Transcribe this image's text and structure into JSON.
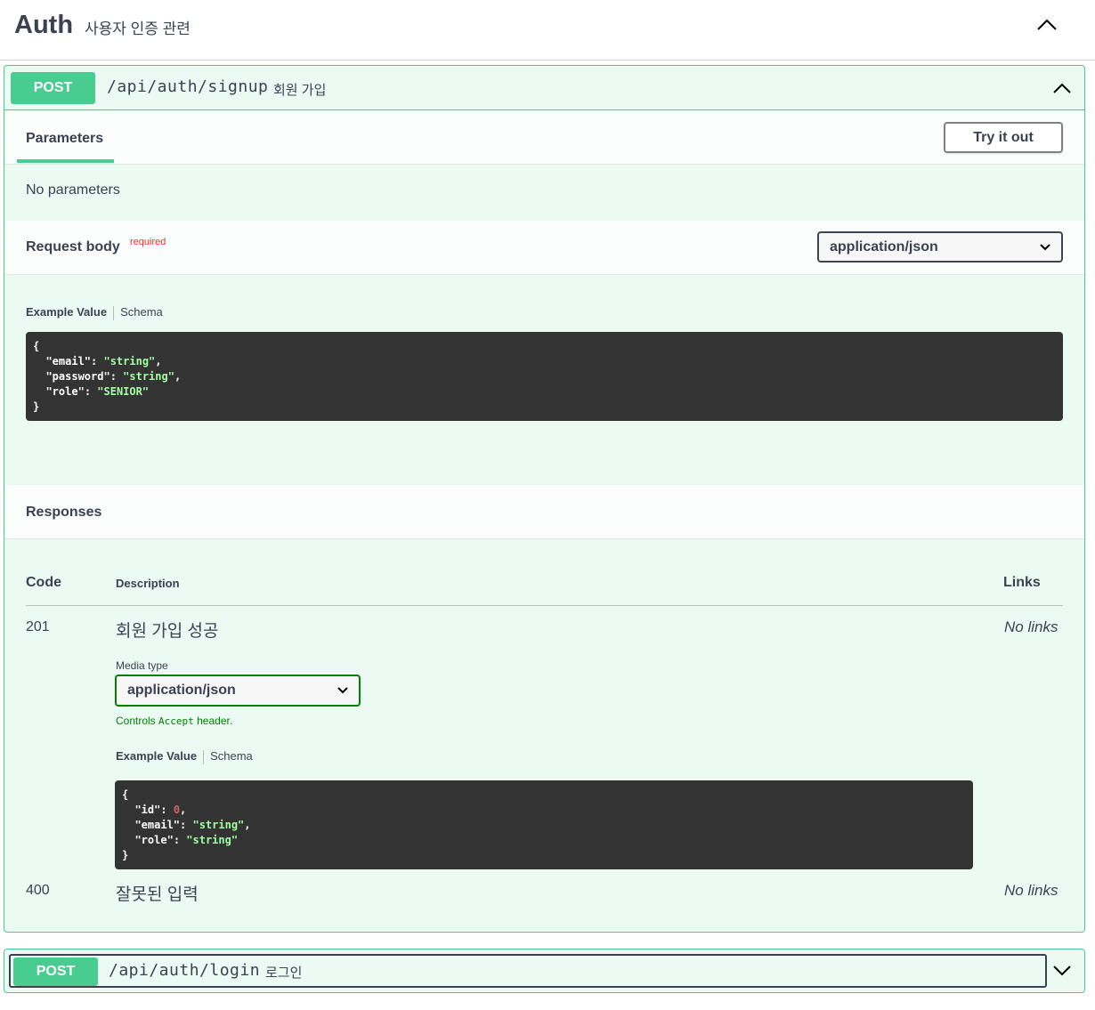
{
  "tag": {
    "title": "Auth",
    "description": "사용자 인증 관련"
  },
  "signup": {
    "method": "POST",
    "path": "/api/auth/signup",
    "summary": "회원 가입",
    "parameters_tab": "Parameters",
    "try_it_out": "Try it out",
    "no_parameters": "No parameters",
    "request_body_label": "Request body",
    "required_label": "required",
    "content_type": "application/json",
    "example_value_tab": "Example Value",
    "schema_tab": "Schema",
    "request_example": {
      "open": "{",
      "close": "}",
      "lines": [
        {
          "key": "\"email\"",
          "value": "\"string\"",
          "comma": ","
        },
        {
          "key": "\"password\"",
          "value": "\"string\"",
          "comma": ","
        },
        {
          "key": "\"role\"",
          "value": "\"SENIOR\"",
          "comma": ""
        }
      ]
    },
    "responses_label": "Responses",
    "columns": {
      "code": "Code",
      "description": "Description",
      "links": "Links"
    },
    "responses": [
      {
        "code": "201",
        "description": "회원 가입 성공",
        "links": "No links",
        "media_type_label": "Media type",
        "media_type": "application/json",
        "controls_prefix": "Controls",
        "controls_code": "Accept",
        "controls_suffix": "header.",
        "example_value_tab": "Example Value",
        "schema_tab": "Schema",
        "example": {
          "open": "{",
          "close": "}",
          "lines": [
            {
              "key": "\"id\"",
              "value": "0",
              "comma": ","
            },
            {
              "key": "\"email\"",
              "value": "\"string\"",
              "comma": ","
            },
            {
              "key": "\"role\"",
              "value": "\"string\"",
              "comma": ""
            }
          ]
        }
      },
      {
        "code": "400",
        "description": "잘못된 입력",
        "links": "No links"
      }
    ]
  },
  "login": {
    "method": "POST",
    "path": "/api/auth/login",
    "summary": "로그인"
  },
  "colors": {
    "post_green": "#49cc90",
    "code_bg": "#333333",
    "string_green": "#a2fca2",
    "number_red": "#d36363",
    "required_red": "#ff2a2a"
  },
  "icons": {
    "tag_toggle": "chevron-up-icon",
    "op_toggle": "chevron-up-icon",
    "select_arrow": "chevron-down-icon",
    "login_toggle": "chevron-down-icon"
  }
}
